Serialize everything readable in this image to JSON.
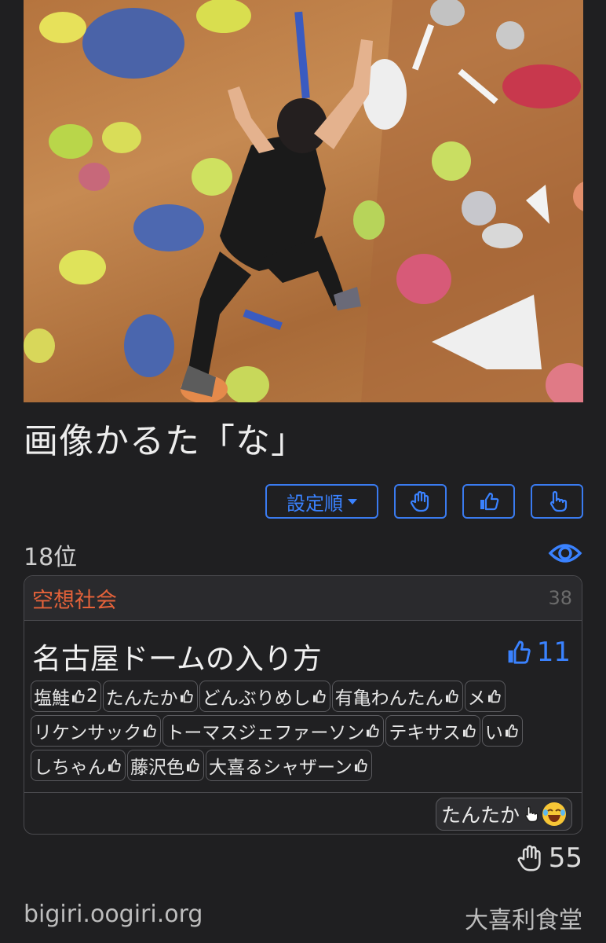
{
  "post": {
    "title": "画像かるた「な」"
  },
  "toolbar": {
    "sort_label": "設定順",
    "icons": [
      "raised-hand-icon",
      "thumbs-up-icon",
      "pointing-up-hand-icon"
    ]
  },
  "rank": {
    "label": "18位"
  },
  "card": {
    "category": "空想社会",
    "count": "38",
    "answer": "名古屋ドームの入り方",
    "likes": "11",
    "voters": [
      {
        "name": "塩鮭",
        "extra": "2"
      },
      {
        "name": "たんたか",
        "extra": ""
      },
      {
        "name": "どんぶりめし",
        "extra": ""
      },
      {
        "name": "有亀わんたん",
        "extra": ""
      },
      {
        "name": "メ",
        "extra": ""
      },
      {
        "name": "リケンサック",
        "extra": ""
      },
      {
        "name": "トーマスジェファーソン",
        "extra": ""
      },
      {
        "name": "テキサス",
        "extra": ""
      },
      {
        "name": "い",
        "extra": ""
      },
      {
        "name": "しちゃん",
        "extra": ""
      },
      {
        "name": "藤沢色",
        "extra": ""
      },
      {
        "name": "大喜るシャザーン",
        "extra": ""
      }
    ],
    "reaction": {
      "name": "たんたか",
      "icons": [
        "pointing-hand-icon",
        "laughing-emoji-icon"
      ]
    }
  },
  "hand_count": "55",
  "footer": {
    "site": "bigiri.oogiri.org",
    "brand": "大喜利食堂"
  },
  "colors": {
    "background": "#1f1f21",
    "accent": "#3a82ff",
    "category": "#e4623a"
  }
}
